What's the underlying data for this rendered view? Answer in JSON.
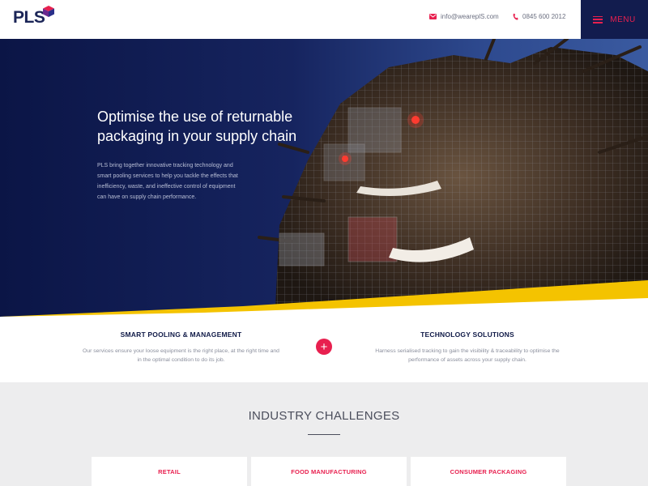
{
  "header": {
    "logo_text": "PLS",
    "email": "info@weareplS.com",
    "phone": "0845 600 2012",
    "menu_label": "MENU"
  },
  "hero": {
    "title": "Optimise the use of returnable packaging in your supply chain",
    "description": "PLS bring together innovative tracking technology and smart pooling services to help you tackle the effects that inefficiency, waste, and ineffective control of equipment can have on supply chain performance."
  },
  "services": {
    "left": {
      "title": "SMART POOLING & MANAGEMENT",
      "text": "Our services ensure your loose equipment is the right place, at the right time and in the optimal condition to do its job."
    },
    "plus_symbol": "+",
    "right": {
      "title": "TECHNOLOGY SOLUTIONS",
      "text": "Harness serialised tracking to gain the visibility & traceability to optimise the performance of assets across your supply chain."
    }
  },
  "industry": {
    "title": "INDUSTRY CHALLENGES",
    "cards": [
      "RETAIL",
      "FOOD MANUFACTURING",
      "CONSUMER PACKAGING"
    ]
  },
  "colors": {
    "navy": "#121c4e",
    "accent": "#e8204f",
    "yellow": "#f4c300"
  },
  "icons": [
    "pls-logo-cube",
    "mail-icon",
    "phone-icon",
    "hamburger-icon",
    "plus-icon"
  ]
}
